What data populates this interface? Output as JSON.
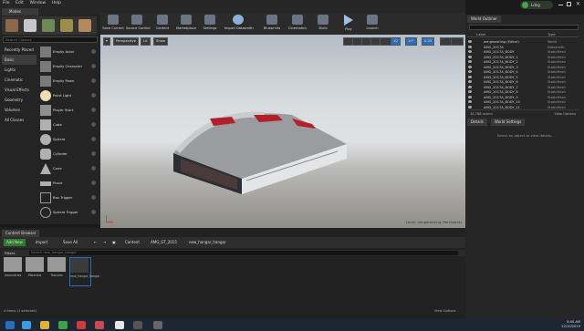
{
  "menu": [
    "File",
    "Edit",
    "Window",
    "Help"
  ],
  "user_badge": "Ldng",
  "modes_tab": "Modes",
  "search_placeholder": "Search Classes",
  "categories": [
    "Recently Placed",
    "Basic",
    "Lights",
    "Cinematic",
    "Visual Effects",
    "Geometry",
    "Volumes",
    "All Classes"
  ],
  "placeables": [
    "Empty Actor",
    "Empty Character",
    "Empty Pawn",
    "Point Light",
    "Player Start",
    "Cube",
    "Sphere",
    "Cylinder",
    "Cone",
    "Plane",
    "Box Trigger",
    "Sphere Trigger"
  ],
  "toolbar": [
    "Save Current",
    "Source Control",
    "Content",
    "Marketplace",
    "Settings",
    "Import Datasmith",
    "Blueprints",
    "Cinematics",
    "Build",
    "Play",
    "Launch"
  ],
  "viewport": {
    "perspective": "Perspective",
    "lit": "Lit",
    "show": "Show",
    "snap_value": "10",
    "rot_value": "10°",
    "scale_value": "0.25",
    "level_label": "Level: aengineshing (Persistent)"
  },
  "outliner": {
    "tab": "World Outliner",
    "col_label": "Label",
    "col_type": "Type",
    "rows": [
      [
        "aengineshing (Editor)",
        "World"
      ],
      [
        "AMG_2017A",
        "Datasmith"
      ],
      [
        "AMG_2017A_BODY",
        "StaticMesh"
      ],
      [
        "AMG_2017A_BODY_1",
        "StaticMesh"
      ],
      [
        "AMG_2017A_BODY_2",
        "StaticMesh"
      ],
      [
        "AMG_2017A_BODY_3",
        "StaticMesh"
      ],
      [
        "AMG_2017A_BODY_4",
        "StaticMesh"
      ],
      [
        "AMG_2017A_BODY_5",
        "StaticMesh"
      ],
      [
        "AMG_2017A_BODY_6",
        "StaticMesh"
      ],
      [
        "AMG_2017A_BODY_7",
        "StaticMesh"
      ],
      [
        "AMG_2017A_BODY_8",
        "StaticMesh"
      ],
      [
        "AMG_2017A_BODY_9",
        "StaticMesh"
      ],
      [
        "AMG_2017A_BODY_10",
        "StaticMesh"
      ],
      [
        "AMG_2017A_BODY_11",
        "StaticMesh"
      ]
    ],
    "footer": "18,788 actors",
    "view_options": "View Options"
  },
  "details": {
    "tab1": "Details",
    "tab2": "World Settings",
    "empty": "Select an object to view details."
  },
  "content_browser": {
    "tab": "Content Browser",
    "add_new": "Add New",
    "import": "Import",
    "save_all": "Save All",
    "path": [
      "Content",
      "AMG_GT_2015",
      "new_hangar_hangar"
    ],
    "filters": "Filters",
    "search_placeholder": "Search new_hangar_hangar",
    "assets": [
      "Geometries",
      "Materials",
      "Textures",
      "new_hangar_hangar"
    ],
    "items_count": "4 items (1 selected)",
    "view_options": "View Options"
  },
  "taskbar": {
    "time": "8:00 AM",
    "date": "22/10/2019"
  },
  "colors": {
    "accent": "#2a6ebb",
    "red_panels": "#b2212b",
    "hangar": "#dfe2e4"
  }
}
